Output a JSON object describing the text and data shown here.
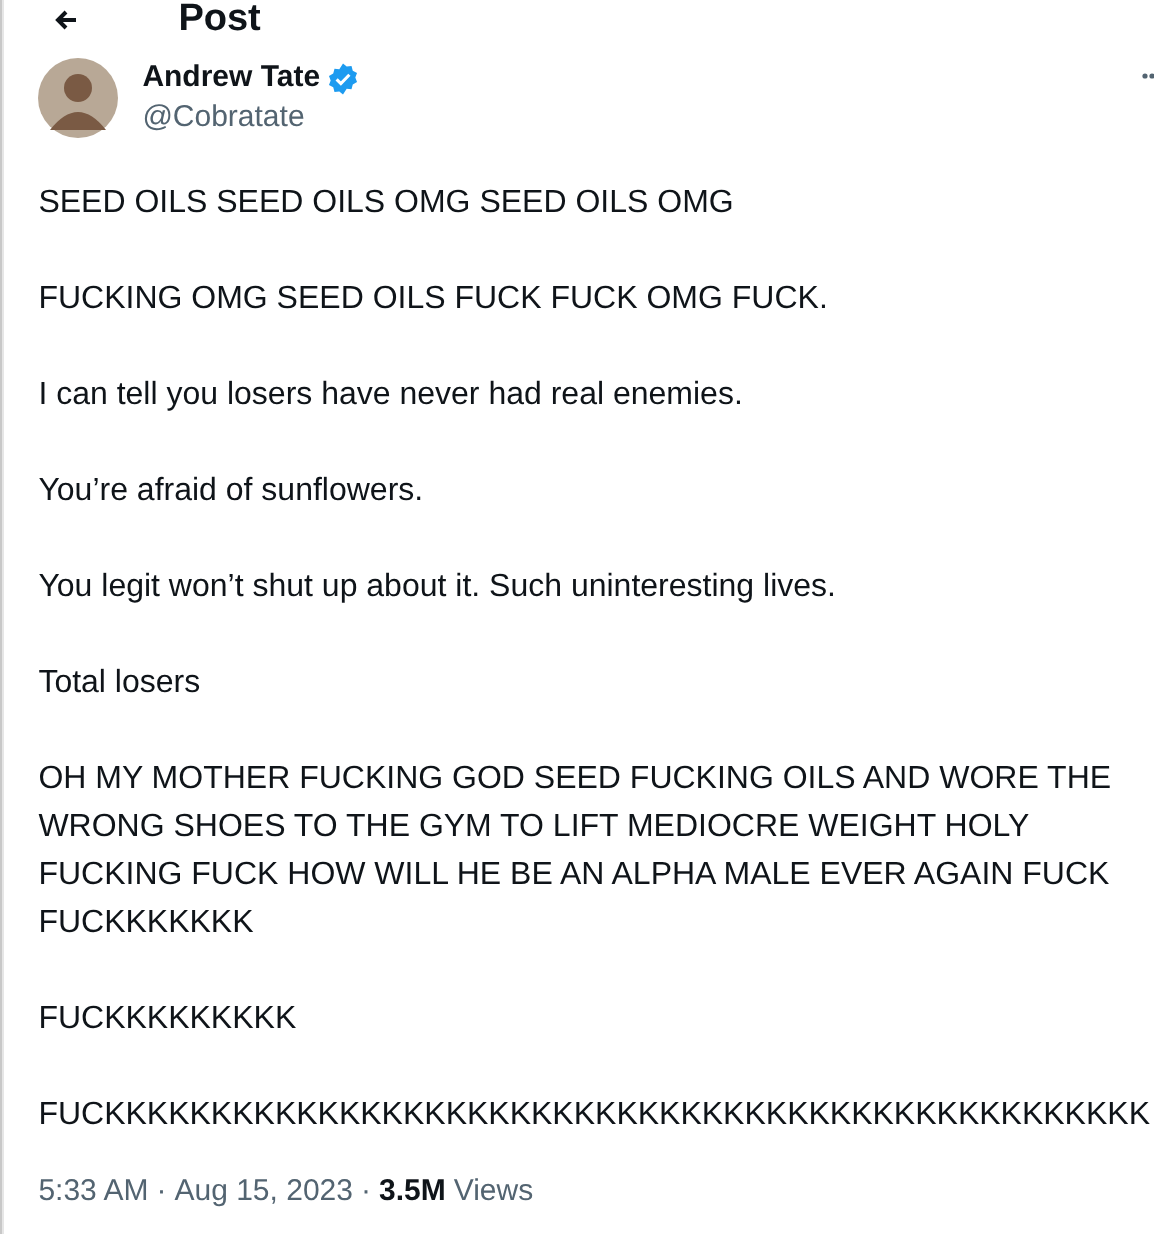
{
  "header": {
    "title": "Post"
  },
  "author": {
    "name": "Andrew Tate",
    "verified": true,
    "handle": "@Cobratate"
  },
  "paragraphs": [
    "SEED OILS SEED OILS OMG SEED OILS OMG",
    "FUCKING OMG SEED OILS FUCK FUCK OMG FUCK.",
    "I can tell you losers have never had real enemies.",
    "You’re afraid of sunflowers.",
    "You legit won’t shut up about it. Such uninteresting lives.",
    "Total losers",
    "OH MY MOTHER FUCKING GOD SEED FUCKING OILS AND WORE THE WRONG SHOES TO THE GYM TO LIFT MEDIOCRE WEIGHT HOLY FUCKING FUCK HOW WILL HE BE AN ALPHA MALE EVER AGAIN FUCK FUCKKKKKKK",
    "FUCKKKKKKKKK",
    "FUCKKKKKKKKKKKKKKKKKKKKKKKKKKKKKKKKKKKKKKKKKKKKKKKKK"
  ],
  "meta": {
    "time": "5:33 AM",
    "separator_1": "·",
    "date": "Aug 15, 2023",
    "separator_2": "·",
    "views_count": "3.5M",
    "views_label": "Views"
  }
}
